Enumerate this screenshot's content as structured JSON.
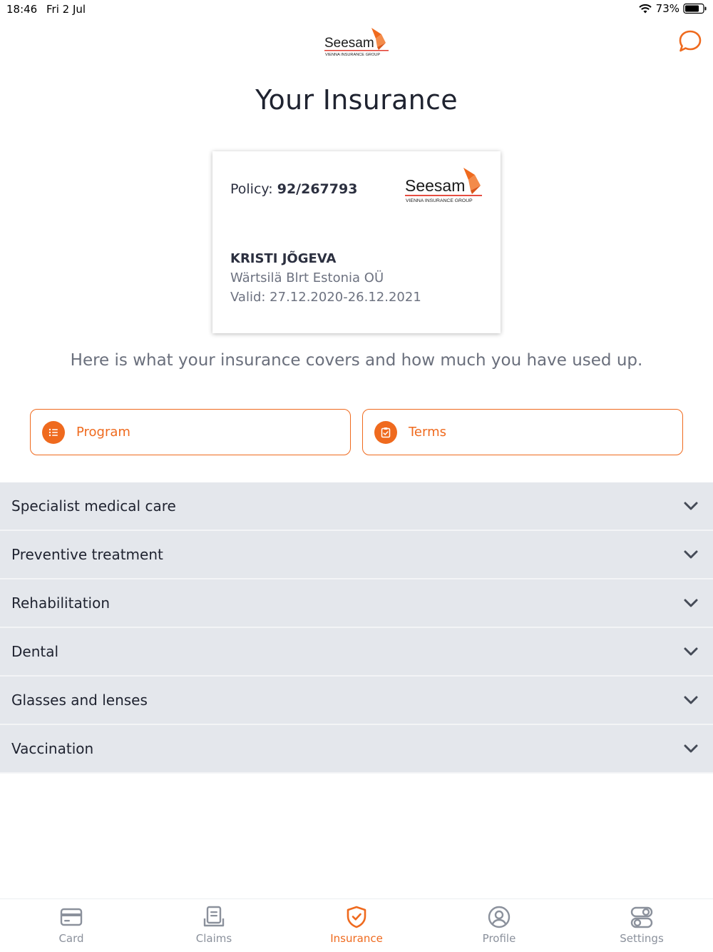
{
  "status_bar": {
    "time": "18:46",
    "date": "Fri 2 Jul",
    "battery": "73%"
  },
  "brand": {
    "name": "Seesam",
    "tagline": "VIENNA INSURANCE GROUP"
  },
  "page": {
    "title": "Your Insurance"
  },
  "card": {
    "policy_label": "Policy:",
    "policy_number": "92/267793",
    "holder_name": "KRISTI JÕGEVA",
    "company": "Wärtsilä Blrt Estonia OÜ",
    "valid": "Valid: 27.12.2020-26.12.2021"
  },
  "intro": "Here is what your insurance covers and how much you have used up.",
  "buttons": {
    "program": "Program",
    "terms": "Terms"
  },
  "coverage": [
    {
      "label": "Specialist medical care"
    },
    {
      "label": "Preventive treatment"
    },
    {
      "label": "Rehabilitation"
    },
    {
      "label": "Dental"
    },
    {
      "label": "Glasses and lenses"
    },
    {
      "label": "Vaccination"
    }
  ],
  "tabs": [
    {
      "label": "Card"
    },
    {
      "label": "Claims"
    },
    {
      "label": "Insurance"
    },
    {
      "label": "Profile"
    },
    {
      "label": "Settings"
    }
  ],
  "colors": {
    "accent": "#ef6a1e",
    "row_bg": "#e4e7ec",
    "text": "#1f2330"
  }
}
